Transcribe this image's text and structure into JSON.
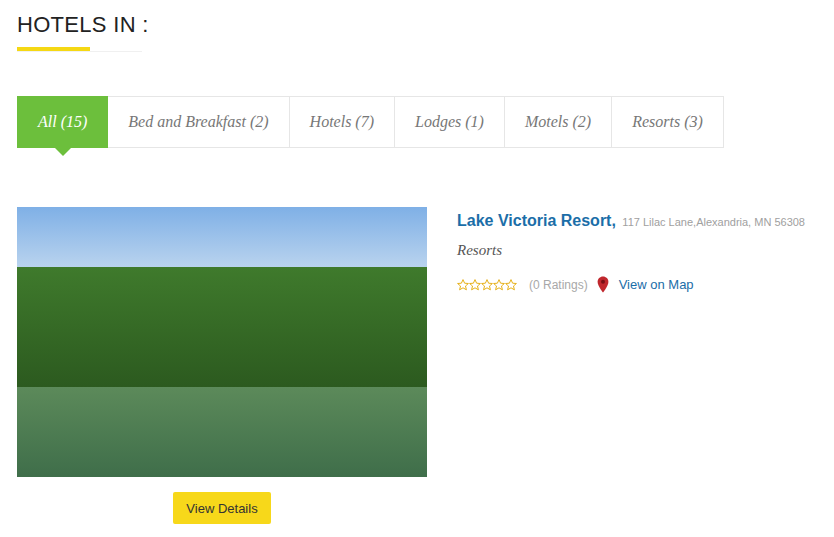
{
  "page": {
    "title": "HOTELS IN :"
  },
  "tabs": [
    {
      "label": "All (15)",
      "selected": true
    },
    {
      "label": "Bed and Breakfast (2)",
      "selected": false
    },
    {
      "label": "Hotels (7)",
      "selected": false
    },
    {
      "label": "Lodges (1)",
      "selected": false
    },
    {
      "label": "Motels (2)",
      "selected": false
    },
    {
      "label": "Resorts (3)",
      "selected": false
    }
  ],
  "listing": {
    "name": "Lake Victoria Resort,",
    "address": "117 Lilac Lane,Alexandria, MN 56308",
    "category": "Resorts",
    "stars": 0,
    "ratings": "(0 Ratings)",
    "map_link": "View on Map",
    "button": "View Details"
  }
}
